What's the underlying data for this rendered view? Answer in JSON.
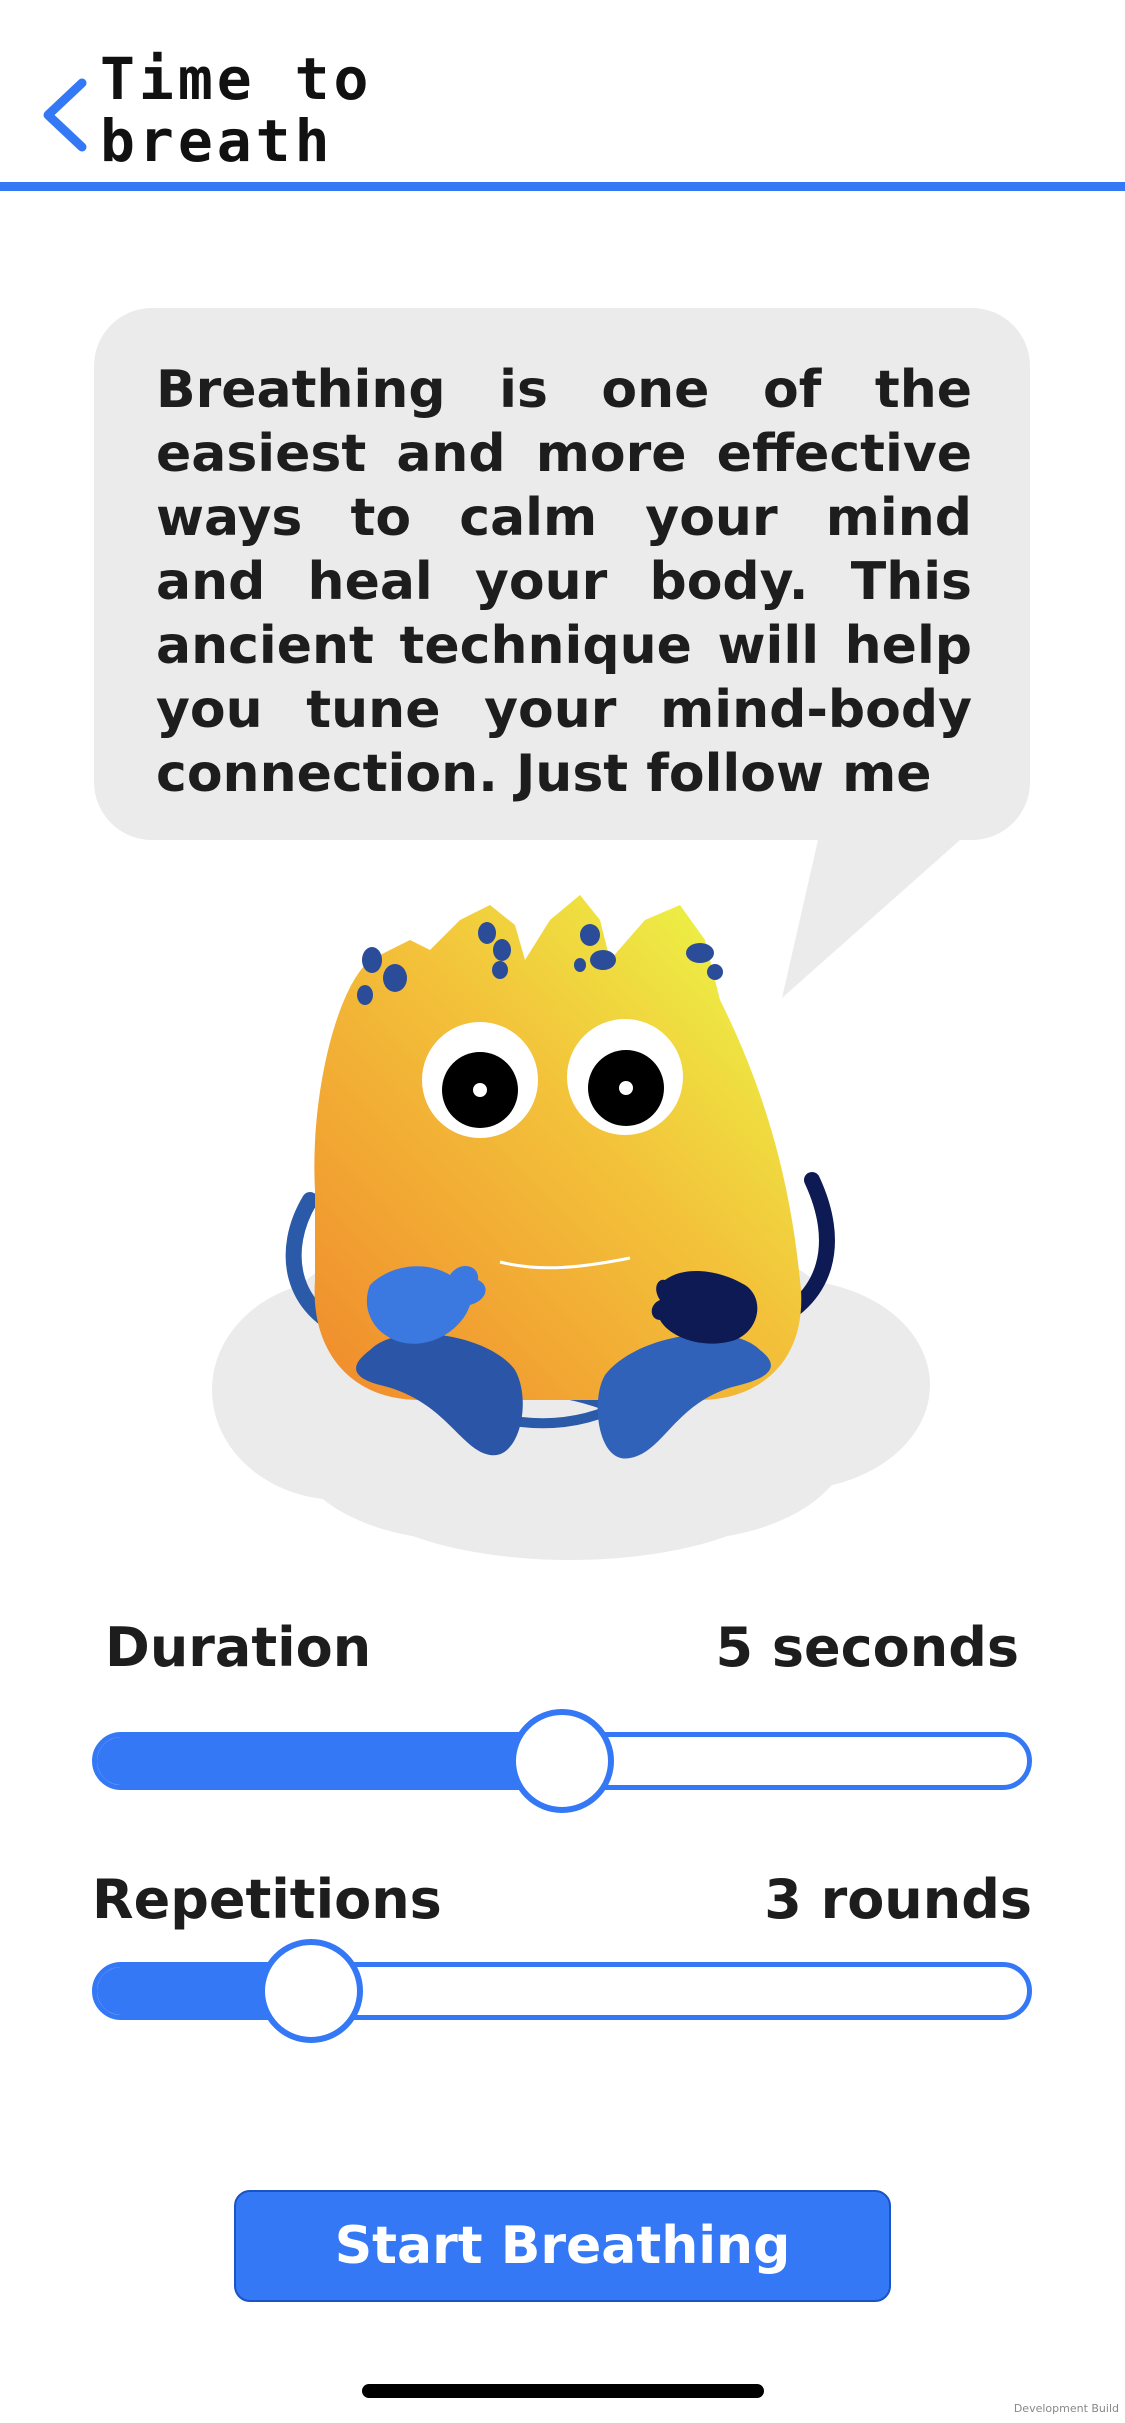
{
  "header": {
    "title_line1": "Time to",
    "title_line2": "breath",
    "accent_color": "#3478f6",
    "back_icon": "chevron-left-icon"
  },
  "bubble": {
    "text": "Breathing is one of the easiest and more effective ways to calm your mind and heal your body. This ancient technique will help you tune your mind-body connection. Just follow me"
  },
  "duration": {
    "label": "Duration",
    "value_text": "5 seconds",
    "level": 0.5
  },
  "repetitions": {
    "label": "Repetitions",
    "value_text": "3 rounds",
    "level": 0.23
  },
  "start_button": {
    "label": "Start Breathing"
  },
  "footer": {
    "dev_build": "Development Build"
  }
}
